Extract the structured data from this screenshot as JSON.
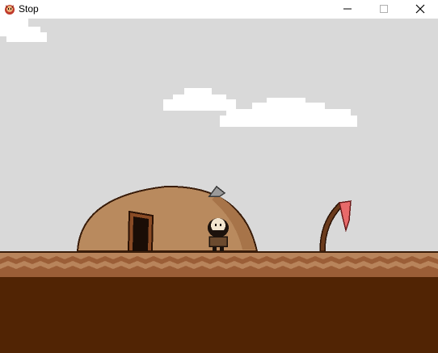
{
  "window": {
    "title": "Stop",
    "app_icon": "red-creature-icon"
  },
  "controls": {
    "minimize_icon": "minimize-icon",
    "maximize_icon": "maximize-icon",
    "close_icon": "close-icon"
  },
  "colors": {
    "sky": "#d9d9d9",
    "cloud": "#ffffff",
    "hut": "#b98a5e",
    "hut_shade": "#a77449",
    "ground_top": "#b8845b",
    "ground_wave": "#9b5e37",
    "soil": "#512404",
    "flag": "#e86a6a",
    "pole": "#6b3b1c"
  }
}
